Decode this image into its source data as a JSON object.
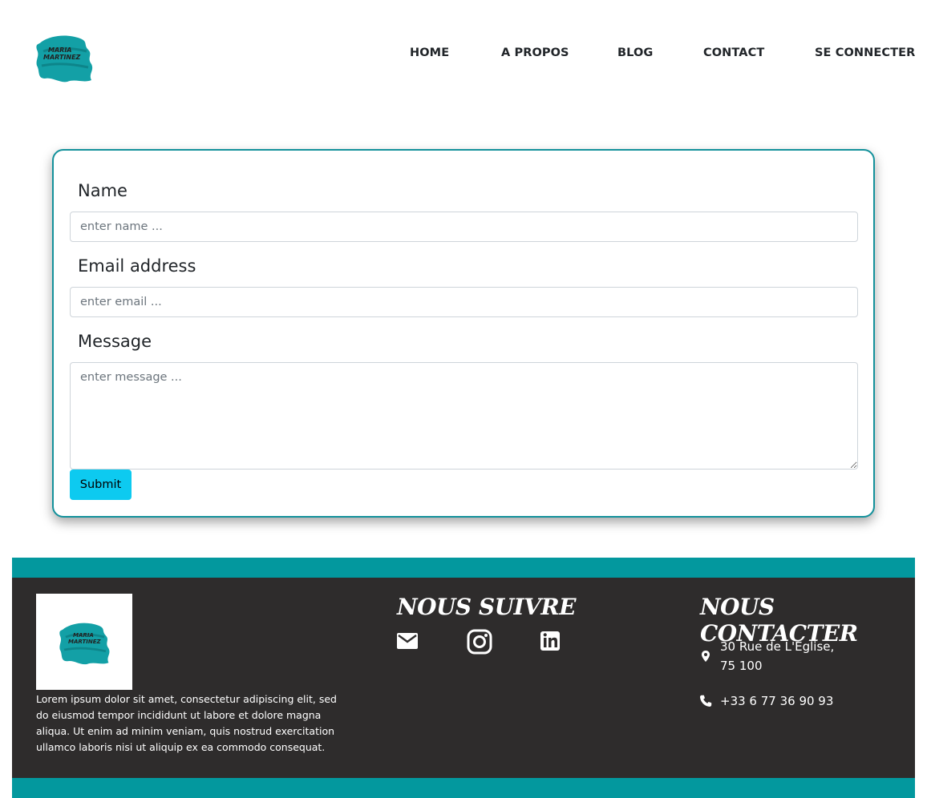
{
  "header": {
    "logo_text_line1": "MARIA",
    "logo_text_line2": "MARTINEZ",
    "nav": {
      "home": "HOME",
      "about": "A PROPOS",
      "blog": "BLOG",
      "contact": "CONTACT",
      "login": "SE CONNECTER"
    }
  },
  "form": {
    "name_label": "Name",
    "name_placeholder": "enter name ...",
    "email_label": "Email address",
    "email_placeholder": "enter email ...",
    "message_label": "Message",
    "message_placeholder": "enter message ...",
    "submit_label": "Submit"
  },
  "footer": {
    "description": "Lorem ipsum dolor sit amet, consectetur adipiscing elit, sed do eiusmod tempor incididunt ut labore et dolore magna aliqua. Ut enim ad minim veniam, quis nostrud exercitation ullamco laboris nisi ut aliquip ex ea commodo consequat.",
    "follow_title": "NOUS SUIVRE",
    "contact_title": "NOUS CONTACTER",
    "address_line1": "30 Rue de L'Eglise,",
    "address_line2": "75 100",
    "phone": "+33 6 77 36 90 93",
    "social_icons": [
      "mail-icon",
      "instagram-icon",
      "linkedin-icon"
    ]
  },
  "colors": {
    "accent_teal": "#03989e",
    "card_border": "#13919b",
    "submit_button": "#0dcaf0",
    "footer_background": "#2e2c2c"
  }
}
